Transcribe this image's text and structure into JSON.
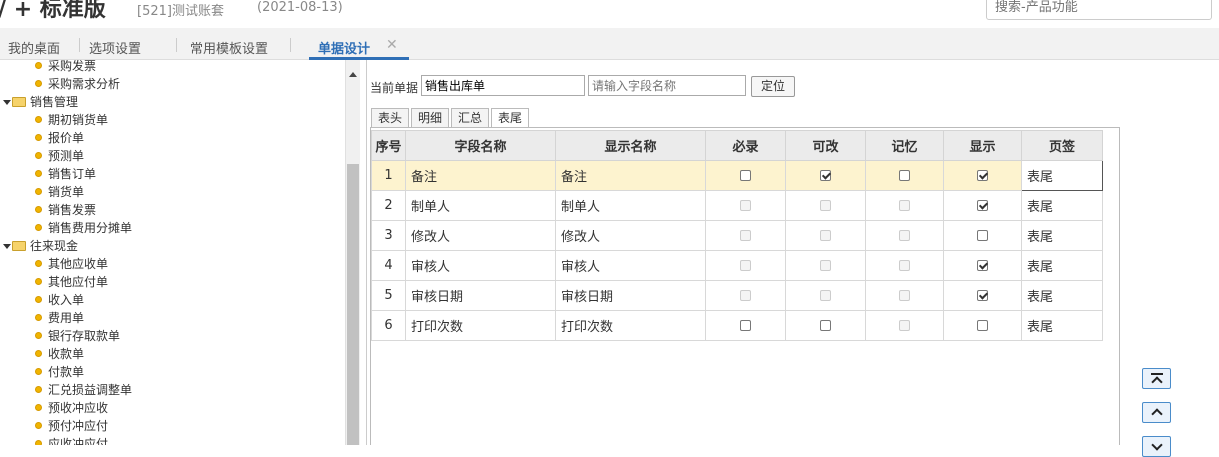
{
  "header": {
    "brand": "/ + 标准版",
    "account": "[521]测试账套",
    "date": "(2021-08-13)",
    "search_placeholder": "搜索-产品功能"
  },
  "tabs": [
    {
      "label": "我的桌面"
    },
    {
      "label": "选项设置"
    },
    {
      "label": "常用模板设置"
    },
    {
      "label": "单据设计",
      "active": true
    }
  ],
  "tree": {
    "items": [
      {
        "label": "采购发票",
        "type": "leaf"
      },
      {
        "label": "采购需求分析",
        "type": "leaf"
      },
      {
        "label": "销售管理",
        "type": "group"
      },
      {
        "label": "期初销货单",
        "type": "leaf"
      },
      {
        "label": "报价单",
        "type": "leaf"
      },
      {
        "label": "预测单",
        "type": "leaf"
      },
      {
        "label": "销售订单",
        "type": "leaf"
      },
      {
        "label": "销货单",
        "type": "leaf"
      },
      {
        "label": "销售发票",
        "type": "leaf"
      },
      {
        "label": "销售费用分摊单",
        "type": "leaf"
      },
      {
        "label": "往来现金",
        "type": "group"
      },
      {
        "label": "其他应收单",
        "type": "leaf"
      },
      {
        "label": "其他应付单",
        "type": "leaf"
      },
      {
        "label": "收入单",
        "type": "leaf"
      },
      {
        "label": "费用单",
        "type": "leaf"
      },
      {
        "label": "银行存取款单",
        "type": "leaf"
      },
      {
        "label": "收款单",
        "type": "leaf"
      },
      {
        "label": "付款单",
        "type": "leaf"
      },
      {
        "label": "汇兑损益调整单",
        "type": "leaf"
      },
      {
        "label": "预收冲应收",
        "type": "leaf"
      },
      {
        "label": "预付冲应付",
        "type": "leaf"
      },
      {
        "label": "应收冲应付",
        "type": "leaf"
      }
    ]
  },
  "form": {
    "current_label": "当前单据",
    "current_value": "销售出库单",
    "field_placeholder": "请输入字段名称",
    "locate_button": "定位"
  },
  "subtabs": [
    {
      "label": "表头"
    },
    {
      "label": "明细"
    },
    {
      "label": "汇总"
    },
    {
      "label": "表尾",
      "active": true
    }
  ],
  "grid": {
    "headers": [
      "序号",
      "字段名称",
      "显示名称",
      "必录",
      "可改",
      "记忆",
      "显示",
      "页签"
    ],
    "rows": [
      {
        "no": "1",
        "field": "备注",
        "display": "备注",
        "required": "off",
        "editable": "on",
        "memory": "off",
        "show": "on",
        "page": "表尾"
      },
      {
        "no": "2",
        "field": "制单人",
        "display": "制单人",
        "required": "dis",
        "editable": "dis",
        "memory": "dis",
        "show": "on",
        "page": "表尾"
      },
      {
        "no": "3",
        "field": "修改人",
        "display": "修改人",
        "required": "dis",
        "editable": "dis",
        "memory": "dis",
        "show": "off",
        "page": "表尾"
      },
      {
        "no": "4",
        "field": "审核人",
        "display": "审核人",
        "required": "dis",
        "editable": "dis",
        "memory": "dis",
        "show": "on",
        "page": "表尾"
      },
      {
        "no": "5",
        "field": "审核日期",
        "display": "审核日期",
        "required": "dis",
        "editable": "dis",
        "memory": "dis",
        "show": "on",
        "page": "表尾"
      },
      {
        "no": "6",
        "field": "打印次数",
        "display": "打印次数",
        "required": "off",
        "editable": "off",
        "memory": "dis",
        "show": "off",
        "page": "表尾"
      }
    ]
  },
  "nav_buttons": [
    "move-top",
    "move-up",
    "move-down"
  ]
}
